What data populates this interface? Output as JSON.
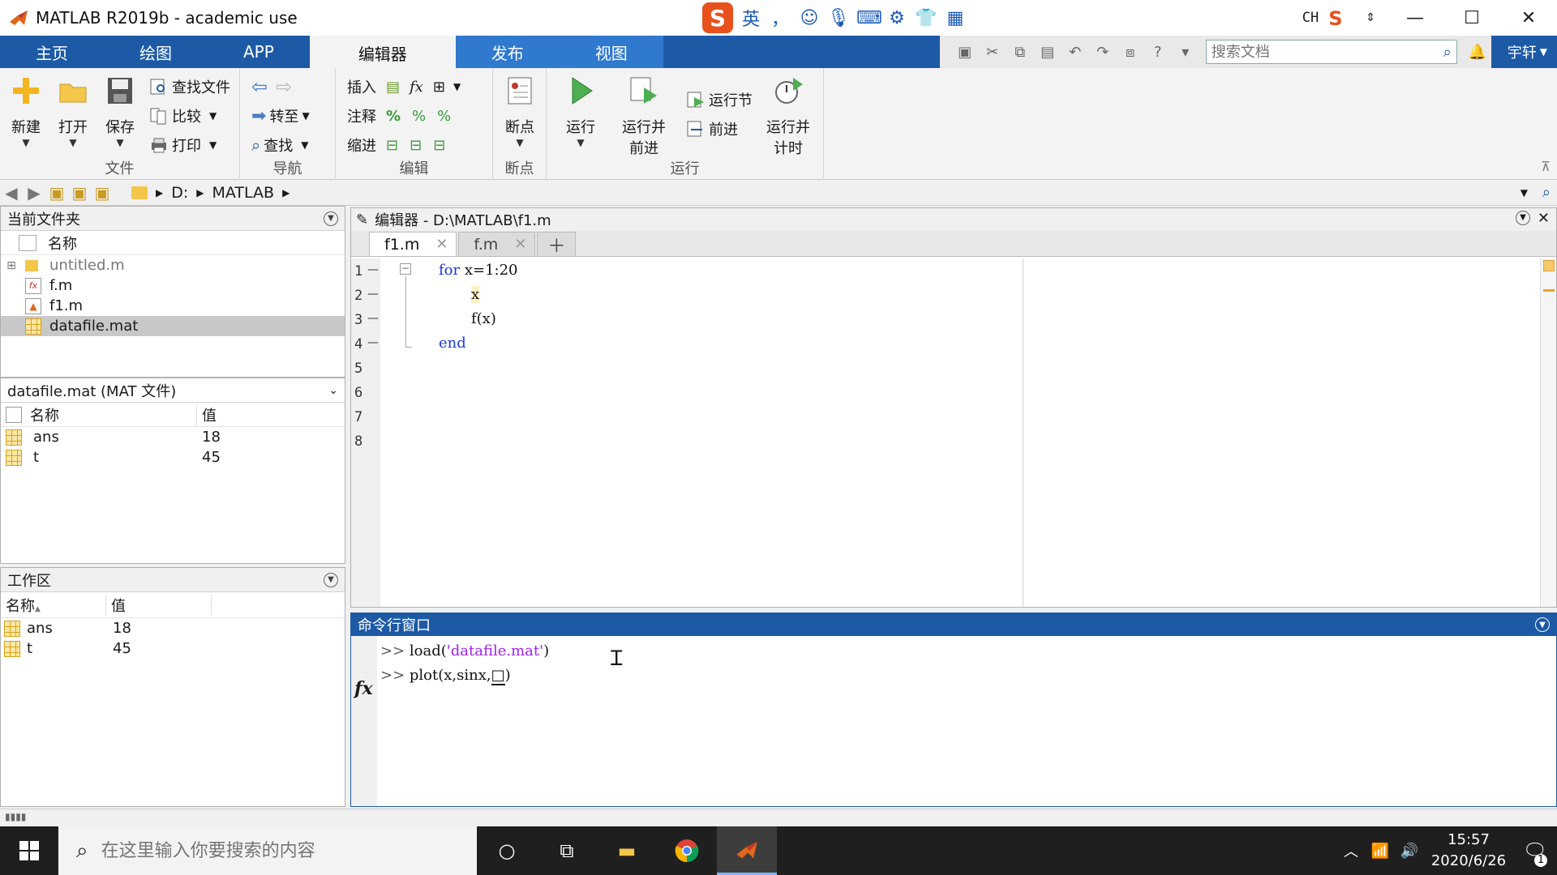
{
  "window": {
    "title": "MATLAB R2019b - academic use"
  },
  "ime": {
    "lang": "英",
    "punct": "，",
    "tray_lang": "CH"
  },
  "ribbon_tabs": [
    "主页",
    "绘图",
    "APP",
    "编辑器",
    "发布",
    "视图"
  ],
  "search": {
    "placeholder": "搜索文档"
  },
  "user": {
    "name": "宇轩"
  },
  "ribbon": {
    "file": {
      "label": "文件",
      "new": "新建",
      "open": "打开",
      "save": "保存",
      "find_files": "查找文件",
      "compare": "比较",
      "print": "打印"
    },
    "nav": {
      "label": "导航",
      "goto": "转至",
      "find": "查找"
    },
    "edit": {
      "label": "编辑",
      "insert": "插入",
      "comment": "注释",
      "indent": "缩进"
    },
    "breakpoint": {
      "label": "断点",
      "btn": "断点"
    },
    "run": {
      "label": "运行",
      "run": "运行",
      "run_advance_1": "运行并",
      "run_advance_2": "前进",
      "run_section": "运行节",
      "advance": "前进",
      "run_time_1": "运行并",
      "run_time_2": "计时"
    }
  },
  "address": {
    "drive": "D:",
    "folder": "MATLAB"
  },
  "current_folder": {
    "title": "当前文件夹",
    "col_name": "名称",
    "files": [
      {
        "name": "untitled.m",
        "type": "folder"
      },
      {
        "name": "f.m",
        "type": "func"
      },
      {
        "name": "f1.m",
        "type": "script"
      },
      {
        "name": "datafile.mat",
        "type": "mat"
      }
    ]
  },
  "details": {
    "title": "datafile.mat  (MAT 文件)",
    "col_name": "名称",
    "col_value": "值",
    "vars": [
      {
        "name": "ans",
        "value": "18"
      },
      {
        "name": "t",
        "value": "45"
      }
    ]
  },
  "workspace": {
    "title": "工作区",
    "col_name": "名称",
    "sort": "▲",
    "col_value": "值",
    "vars": [
      {
        "name": "ans",
        "value": "18"
      },
      {
        "name": "t",
        "value": "45"
      }
    ]
  },
  "editor": {
    "title": "编辑器 - D:\\MATLAB\\f1.m",
    "tabs": [
      "f1.m",
      "f.m"
    ],
    "code": {
      "l1_kw": "for",
      "l1_rest": " x=1:20",
      "l2": "x",
      "l3": "f(x)",
      "l4_kw": "end"
    },
    "line_numbers": [
      "1",
      "2",
      "3",
      "4",
      "5",
      "6",
      "7",
      "8"
    ]
  },
  "command_window": {
    "title": "命令行窗口",
    "prompt": ">>",
    "line1_cmd": "load(",
    "line1_str": "'datafile.mat'",
    "line1_end": ")",
    "line2_cmd": "plot(x,sinx,",
    "line2_caret": "□",
    "line2_end": ")"
  },
  "taskbar": {
    "search_placeholder": "在这里输入你要搜索的内容",
    "time": "15:57",
    "date": "2020/6/26",
    "notifications": "1"
  }
}
